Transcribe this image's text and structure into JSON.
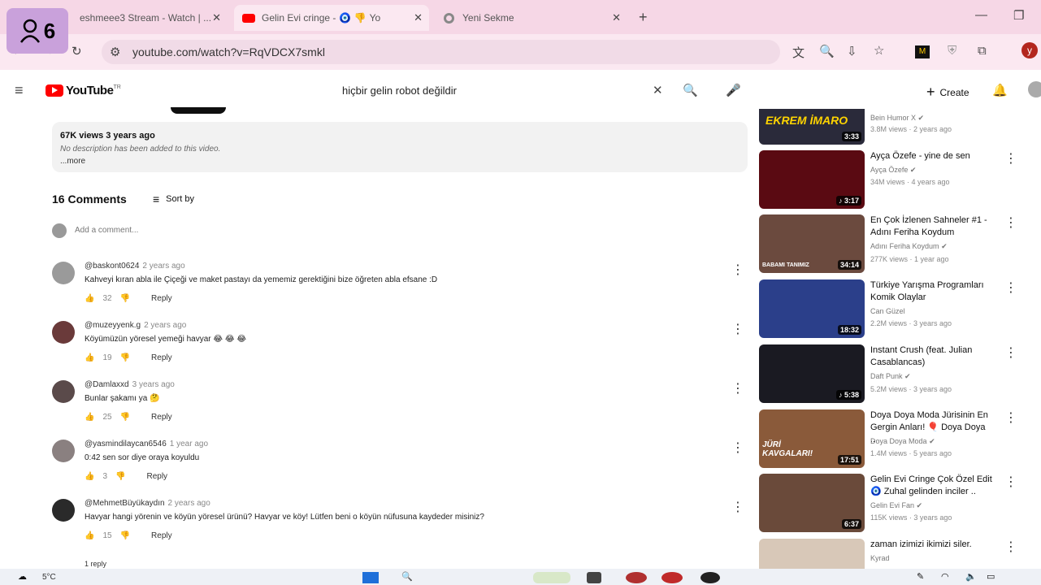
{
  "browser": {
    "tabs": [
      {
        "label": "eshmeee3 Stream - Watch | ..."
      },
      {
        "label": "Gelin Evi cringe - ",
        "suffix": "Yo"
      },
      {
        "label": "Yeni Sekme"
      }
    ],
    "profile_count": "6",
    "url": "youtube.com/watch?v=RqVDCX7smkl",
    "profile_letter": "y"
  },
  "youtube": {
    "logo_text": "YouTube",
    "logo_sup": "TR",
    "search_value": "hiçbir gelin robot değildir",
    "create_label": "Create"
  },
  "video_meta": {
    "views_time": "67K views  3 years ago",
    "description": "No description has been added to this video.",
    "more": "...more"
  },
  "comments_section": {
    "count_label": "16 Comments",
    "sort_label": "Sort by",
    "add_placeholder": "Add a comment...",
    "reply_label": "Reply",
    "items": [
      {
        "user": "@baskont0624",
        "time": "2 years ago",
        "text": "Kahveyi kıran abla ile Çiçeği ve maket pastayı da yememiz gerektiğini bize öğreten abla efsane :D",
        "likes": "32"
      },
      {
        "user": "@muzeyyenk.g",
        "time": "2 years ago",
        "text": "Köyümüzün yöresel yemeği havyar 😂 😂 😂",
        "likes": "19"
      },
      {
        "user": "@Damlaxxd",
        "time": "3 years ago",
        "text": "Bunlar şakamı ya 🤔",
        "likes": "25"
      },
      {
        "user": "@yasmindilaycan6546",
        "time": "1 year ago",
        "text": "0:42 sen sor diye oraya koyuldu",
        "likes": "3"
      },
      {
        "user": "@MehmetBüyükaydın",
        "time": "2 years ago",
        "text": "Havyar hangi yörenin ve köyün yöresel ürünü? Havyar ve köy! Lütfen beni o köyün  nüfusuna kaydeder misiniz?",
        "likes": "15"
      }
    ],
    "replies_label": "1 reply"
  },
  "recommendations": [
    {
      "title": "",
      "channel": "Bein Humor X",
      "stats": "3.8M views · 2 years ago",
      "duration": "3:33",
      "thumb_text": "EKREM İMARO",
      "color": "#2a2a3a"
    },
    {
      "title": "Ayça Özefe - yine de sen",
      "channel": "Ayça Özefe",
      "stats": "34M views · 4 years ago",
      "duration": "♪ 3:17",
      "thumb_text": "",
      "color": "#5a0a12"
    },
    {
      "title": "En Çok İzlenen Sahneler #1 - Adını Feriha Koydum",
      "channel": "Adını Feriha Koydum",
      "stats": "277K views · 1 year ago",
      "duration": "34:14",
      "thumb_text": "BABAMI TANIMIZ",
      "color": "#6b4a3e"
    },
    {
      "title": "Türkiye Yarışma Programları Komik Olaylar",
      "channel": "Can Güzel",
      "stats": "2.2M views · 3 years ago",
      "duration": "18:32",
      "thumb_text": "",
      "color": "#2b3f8a"
    },
    {
      "title": "Instant Crush (feat. Julian Casablancas)",
      "channel": "Daft Punk",
      "stats": "5.2M views · 3 years ago",
      "duration": "♪ 5:38",
      "thumb_text": "",
      "color": "#1a1a22"
    },
    {
      "title": "Doya Doya Moda Jürisinin En Gergin Anları! 🎈 Doya Doya ..",
      "channel": "Doya Doya Moda",
      "stats": "1.4M views · 5 years ago",
      "duration": "17:51",
      "thumb_text": "JÜRİ KAVGALARI!",
      "color": "#8a5a3a"
    },
    {
      "title": "Gelin Evi Cringe Çok Özel Edit 🧿 Zuhal gelinden inciler ..",
      "channel": "Gelin Evi Fan",
      "stats": "115K views · 3 years ago",
      "duration": "6:37",
      "thumb_text": "",
      "color": "#6a4a3a"
    },
    {
      "title": "zaman izimizi ikimizi siler.",
      "channel": "Kyrad",
      "stats": "",
      "duration": "",
      "thumb_text": "",
      "color": "#d8c8b8"
    }
  ],
  "taskbar": {
    "weather": "5°C"
  },
  "colors": {
    "tab_bg": "#f6d7e6",
    "yt_red": "#ff0000",
    "profile_badge": "#c9a1db"
  }
}
